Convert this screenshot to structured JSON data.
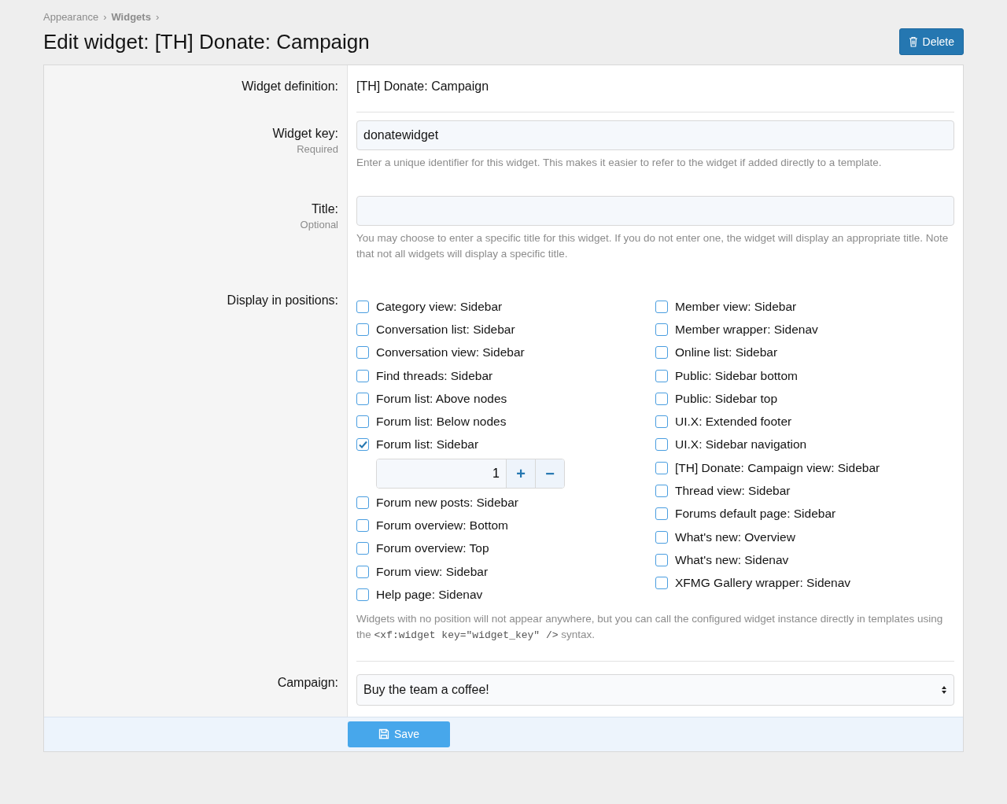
{
  "breadcrumb": [
    {
      "label": "Appearance",
      "bold": false
    },
    {
      "label": "Widgets",
      "bold": true
    }
  ],
  "breadcrumb_separator": "›",
  "title": "Edit widget: [TH] Donate: Campaign",
  "delete_button": {
    "label": "Delete"
  },
  "definition": {
    "label": "Widget definition:",
    "value": "[TH] Donate: Campaign"
  },
  "widget_key": {
    "label": "Widget key:",
    "sublabel": "Required",
    "value": "donatewidget",
    "hint": "Enter a unique identifier for this widget. This makes it easier to refer to the widget if added directly to a template."
  },
  "title_field": {
    "label": "Title:",
    "sublabel": "Optional",
    "hint": "You may choose to enter a specific title for this widget. If you do not enter one, the widget will display an appropriate title. Note that not all widgets will display a specific title."
  },
  "positions": {
    "label": "Display in positions:",
    "columns": [
      [
        {
          "label": "Category view: Sidebar",
          "checked": false
        },
        {
          "label": "Conversation list: Sidebar",
          "checked": false
        },
        {
          "label": "Conversation view: Sidebar",
          "checked": false
        },
        {
          "label": "Find threads: Sidebar",
          "checked": false
        },
        {
          "label": "Forum list: Above nodes",
          "checked": false
        },
        {
          "label": "Forum list: Below nodes",
          "checked": false
        },
        {
          "label": "Forum list: Sidebar",
          "checked": true,
          "order": "1",
          "plus": "+",
          "minus": "−"
        },
        {
          "label": "Forum new posts: Sidebar",
          "checked": false
        },
        {
          "label": "Forum overview: Bottom",
          "checked": false
        },
        {
          "label": "Forum overview: Top",
          "checked": false
        },
        {
          "label": "Forum view: Sidebar",
          "checked": false
        },
        {
          "label": "Help page: Sidenav",
          "checked": false
        }
      ],
      [
        {
          "label": "Member view: Sidebar",
          "checked": false
        },
        {
          "label": "Member wrapper: Sidenav",
          "checked": false
        },
        {
          "label": "Online list: Sidebar",
          "checked": false
        },
        {
          "label": "Public: Sidebar bottom",
          "checked": false
        },
        {
          "label": "Public: Sidebar top",
          "checked": false
        },
        {
          "label": "UI.X: Extended footer",
          "checked": false
        },
        {
          "label": "UI.X: Sidebar navigation",
          "checked": false
        },
        {
          "label": "[TH] Donate: Campaign view: Sidebar",
          "checked": false
        },
        {
          "label": "Thread view: Sidebar",
          "checked": false
        },
        {
          "label": "Forums default page: Sidebar",
          "checked": false
        },
        {
          "label": "What's new: Overview",
          "checked": false
        },
        {
          "label": "What's new: Sidenav",
          "checked": false
        },
        {
          "label": "XFMG Gallery wrapper: Sidenav",
          "checked": false
        }
      ]
    ],
    "hint_before": "Widgets with no position will not appear anywhere, but you can call the configured widget instance directly in templates using the ",
    "hint_code": "<xf:widget key=\"widget_key\" />",
    "hint_after": " syntax."
  },
  "campaign": {
    "label": "Campaign:",
    "value": "Buy the team a coffee!"
  },
  "save_button": {
    "label": "Save"
  }
}
